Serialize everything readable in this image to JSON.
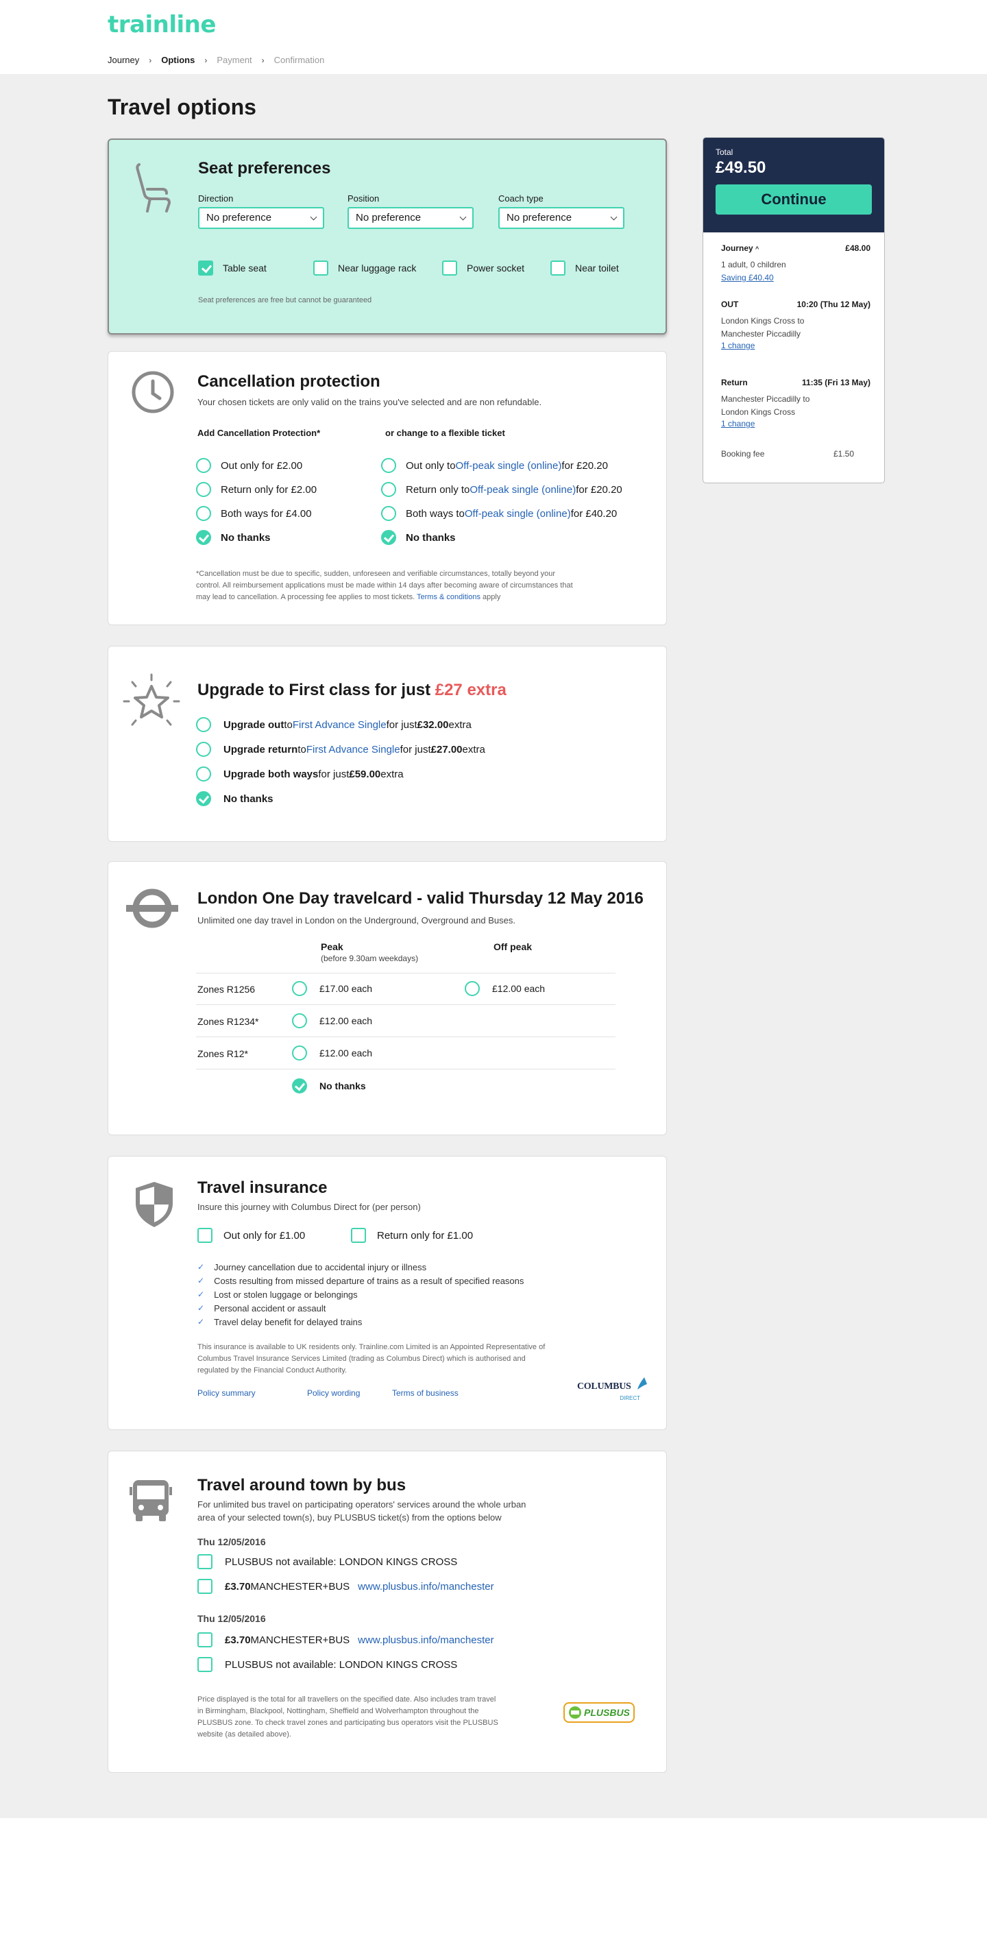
{
  "header": {
    "logo": "trainline",
    "crumbs": [
      "Journey",
      "Options",
      "Payment",
      "Confirmation"
    ]
  },
  "page_title": "Travel options",
  "seat": {
    "title": "Seat preferences",
    "labels": [
      "Direction",
      "Position",
      "Coach type"
    ],
    "values": [
      "No preference",
      "No preference",
      "No preference"
    ],
    "checks": [
      "Table seat",
      "Near luggage rack",
      "Power socket",
      "Near toilet"
    ],
    "note": "Seat preferences are free but cannot be guaranteed"
  },
  "cancel": {
    "title": "Cancellation protection",
    "sub": "Your chosen tickets are only valid on the trains you've selected and are non refundable.",
    "left_head": "Add Cancellation Protection*",
    "right_head": "or change to a flexible ticket",
    "left": [
      "Out only for £2.00",
      "Return only for £2.00",
      "Both ways for £4.00",
      "No thanks"
    ],
    "right_pre": [
      "Out only to ",
      "Return only to ",
      "Both ways  to "
    ],
    "right_link": "Off-peak single (online)",
    "right_post": [
      " for £20.20",
      " for £20.20",
      " for £40.20"
    ],
    "right_none": "No thanks",
    "note1": "*Cancellation must be due to specific, sudden, unforeseen and verifiable circumstances, totally beyond your",
    "note2": "control. All reimbursement applications must be made within 14 days after becoming aware of circumstances that",
    "note3": "may lead to cancellation. A processing fee applies to most tickets. ",
    "terms": "Terms & conditions",
    "apply": " apply"
  },
  "upgrade": {
    "title": "Upgrade to First class for just ",
    "title_price": "£27 extra",
    "o1a": "Upgrade out",
    "o1b": " to ",
    "o1l": "First Advance Single",
    "o1c": " for just ",
    "o1p": "£32.00",
    "o1d": " extra",
    "o2a": "Upgrade return",
    "o2p": "£27.00",
    "o3a": "Upgrade both ways",
    "o3b": " for just ",
    "o3p": "£59.00",
    "o3d": " extra",
    "none": "No thanks"
  },
  "travelcard": {
    "title": "London One Day travelcard - valid Thursday 12 May 2016",
    "sub": "Unlimited one day travel in London on the Underground, Overground and Buses.",
    "peak": "Peak",
    "peak_sub": "(before 9.30am weekdays)",
    "offpeak": "Off peak",
    "rows": [
      {
        "zone": "Zones R1256",
        "peak": "£17.00 each",
        "off": "£12.00 each"
      },
      {
        "zone": "Zones R1234*",
        "peak": "£12.00 each",
        "off": ""
      },
      {
        "zone": "Zones R12*",
        "peak": "£12.00 each",
        "off": ""
      }
    ],
    "none": "No thanks"
  },
  "insurance": {
    "title": "Travel insurance",
    "sub": "Insure this journey with Columbus Direct for (per person)",
    "c1": "Out only for £1.00",
    "c2": "Return only for £1.00",
    "bullets": [
      "Journey cancellation due to accidental injury or illness",
      "Costs resulting from missed departure of trains as a result of specified reasons",
      "Lost or stolen luggage or belongings",
      "Personal accident or assault",
      "Travel delay benefit for delayed trains"
    ],
    "note1": "This insurance is available to UK residents only. Trainline.com Limited is an Appointed Representative of",
    "note2": "Columbus Travel Insurance Services Limited (trading as Columbus Direct) which is authorised and",
    "note3": "regulated by the Financial Conduct Authority.",
    "links": [
      "Policy summary",
      "Policy wording",
      "Terms of business"
    ],
    "logo": "COLUMBUS",
    "logo_sub": "DIRECT"
  },
  "bus": {
    "title": "Travel around town by bus",
    "sub1": "For unlimited bus travel on participating operators' services around the whole urban",
    "sub2": "area of your selected town(s), buy PLUSBUS ticket(s) from the options below",
    "date1": "Thu 12/05/2016",
    "date2": "Thu 12/05/2016",
    "na": "PLUSBUS not available: LONDON KINGS CROSS",
    "price": "£3.70",
    "mb": " MANCHESTER+BUS",
    "url": "www.plusbus.info/manchester",
    "note1": "Price displayed is the total for all travellers on the specified date. Also includes tram travel",
    "note2": "in Birmingham, Blackpool, Nottingham, Sheffield and Wolverhampton throughout the",
    "note3": "PLUSBUS zone. To check travel zones and participating bus operators visit the PLUSBUS",
    "note4": "website (as detailed above).",
    "logo": "PLUSBUS"
  },
  "summary": {
    "total_label": "Total",
    "total": "£49.50",
    "continue": "Continue",
    "journey": "Journey",
    "journey_price": "£48.00",
    "pax": "1 adult, 0 children",
    "saving": "Saving £40.40",
    "out": "OUT",
    "out_time": "10:20 (Thu 12 May)",
    "out_route1": "London Kings Cross to",
    "out_route2": "Manchester Piccadilly",
    "change": "1 change",
    "ret": "Return",
    "ret_time": "11:35 (Fri 13 May)",
    "ret_route1": "Manchester Piccadilly to",
    "ret_route2": "London Kings Cross",
    "fee": "Booking fee",
    "fee_price": "£1.50"
  },
  "colors": {
    "accent": "#3fd4b0",
    "navy": "#1f2d4d",
    "link": "#2563b5",
    "red": "#e85a5a"
  }
}
